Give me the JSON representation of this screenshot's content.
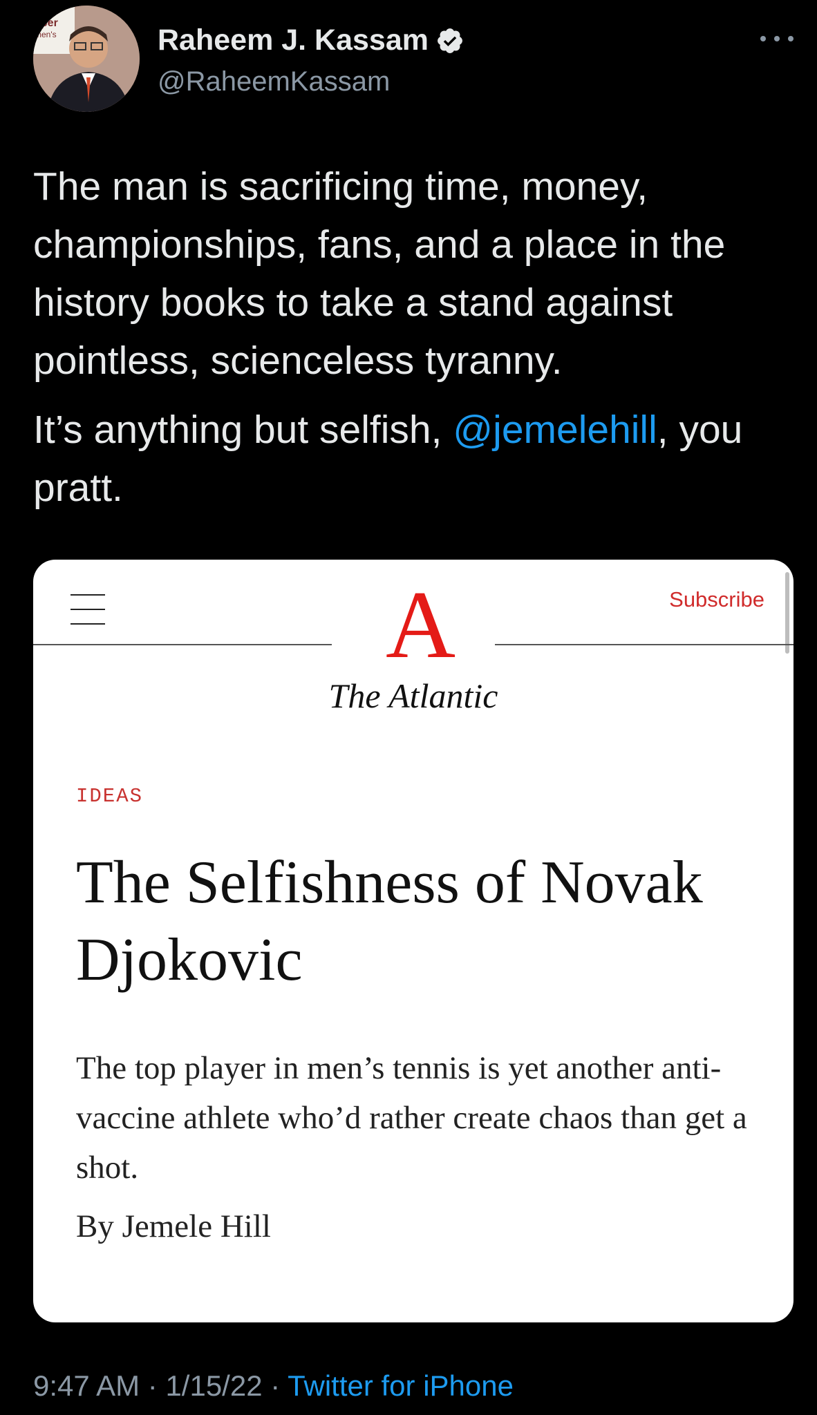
{
  "author": {
    "name": "Raheem J. Kassam",
    "handle": "@RaheemKassam",
    "verified": true
  },
  "tweet": {
    "paragraph1": "The man is sacrificing time, money, championships, fans, and a place in the history books to take a stand against pointless, scienceless tyranny.",
    "paragraph2_before": "It’s anything but selfish, ",
    "mention": "@jemelehill",
    "paragraph2_after": ", you pratt."
  },
  "card": {
    "menu_icon": "hamburger-menu-icon",
    "subscribe_label": "Subscribe",
    "logo_letter": "A",
    "logo_word": "The Atlantic",
    "section": "IDEAS",
    "headline": "The Selfishness of Novak Djokovic",
    "dek": "The top player in men’s tennis is yet another anti-vaccine athlete who’d rather create chaos than get a shot.",
    "byline": "By Jemele Hill"
  },
  "meta": {
    "time": "9:47 AM",
    "separator1": " · ",
    "date": "1/15/22",
    "separator2": " · ",
    "source": "Twitter for iPhone"
  },
  "colors": {
    "background": "#000000",
    "mention": "#1d9bf0",
    "atlantic_red": "#e41b17"
  },
  "avatar_banner_text": "eper\nmen's"
}
